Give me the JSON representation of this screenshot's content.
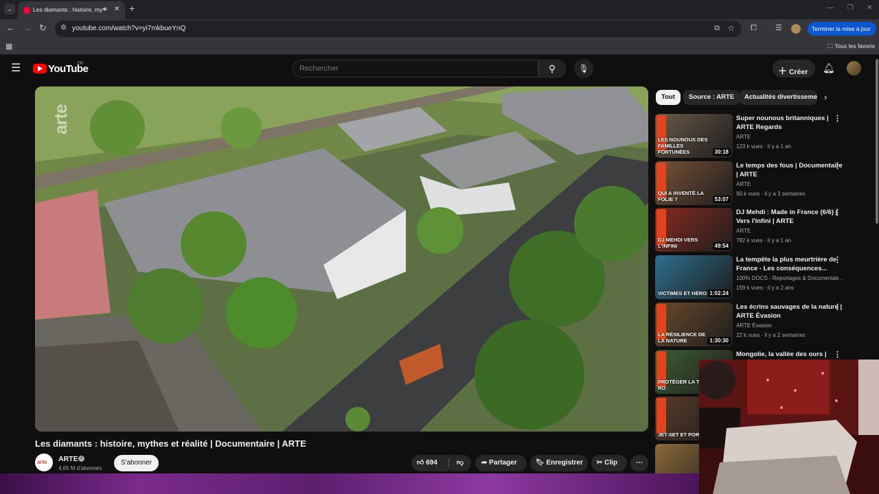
{
  "browser": {
    "tab": {
      "title": "Les diamants : histoire, myth",
      "audio_icon": "speaker-icon",
      "close_icon": "close-icon"
    },
    "url": "youtube.com/watch?v=yi7mkbueYnQ",
    "update_button": "Terminer la mise à jour",
    "bookmarks_all": "Tous les favoris"
  },
  "header": {
    "logo_text": "YouTube",
    "region": "FR",
    "search_placeholder": "Rechercher",
    "create_label": "Créer"
  },
  "video": {
    "title": "Les diamants : histoire, mythes et réalité | Documentaire | ARTE",
    "watermark": "arte",
    "channel": {
      "name": "ARTE",
      "avatar_text": "arte",
      "subscribers": "4,65 M d'abonnés",
      "subscribe_label": "S'abonner"
    },
    "actions": {
      "likes": "694",
      "share": "Partager",
      "save": "Enregistrer",
      "clip": "Clip"
    }
  },
  "chips": [
    "Tout",
    "Source : ARTE",
    "Actualités divertissement"
  ],
  "recommendations": [
    {
      "title": "Super nounous britanniques | ARTE Regards",
      "channel": "ARTE",
      "meta": "123 k vues · il y a 1 an",
      "duration": "30:18",
      "thumb_text": "LES NOUNOUS DES FAMILLES FORTUNÉES",
      "color": "#6b5a48"
    },
    {
      "title": "Le temps des fous | Documentaire | ARTE",
      "channel": "ARTE",
      "meta": "90 k vues · il y a 3 semaines",
      "duration": "53:07",
      "thumb_text": "QUI A INVENTÉ LA FOLIE ?",
      "color": "#7a5236"
    },
    {
      "title": "DJ Mehdi : Made in France (6/6) | Vers l'infini | ARTE",
      "channel": "ARTE",
      "meta": "782 k vues · il y a 1 an",
      "duration": "49:54",
      "thumb_text": "DJ MEHDI VERS L'INFINI",
      "color": "#8a2a1e"
    },
    {
      "title": "La tempête la plus meurtrière de France - Les conséquences...",
      "channel": "100% DOCS - Reportages & Documentair...",
      "meta": "159 k vues · il y a 2 ans",
      "duration": "1:02:24",
      "thumb_text": "VICTIMES ET HÉROS",
      "color": "#2f6f8f"
    },
    {
      "title": "Les écrins sauvages de la nature | ARTE Évasion",
      "channel": "ARTE Évasion",
      "meta": "22 k vues · il y a 2 semaines",
      "duration": "1:30:30",
      "thumb_text": "LA RÉSILIENCE DE LA NATURE",
      "color": "#6b4a2a"
    },
    {
      "title": "Mongolie, la vallée des ours |",
      "channel": "",
      "meta": "",
      "duration": "",
      "thumb_text": "PROTÉGER LA TAÏGA RO",
      "color": "#3e5e33"
    },
    {
      "title": "",
      "channel": "",
      "meta": "",
      "duration": "",
      "thumb_text": "JET-SET ET PORNO",
      "color": "#5a3a2a"
    },
    {
      "title": "",
      "channel": "",
      "meta": "",
      "duration": "",
      "thumb_text": "",
      "color": "#8c6a3a"
    }
  ]
}
